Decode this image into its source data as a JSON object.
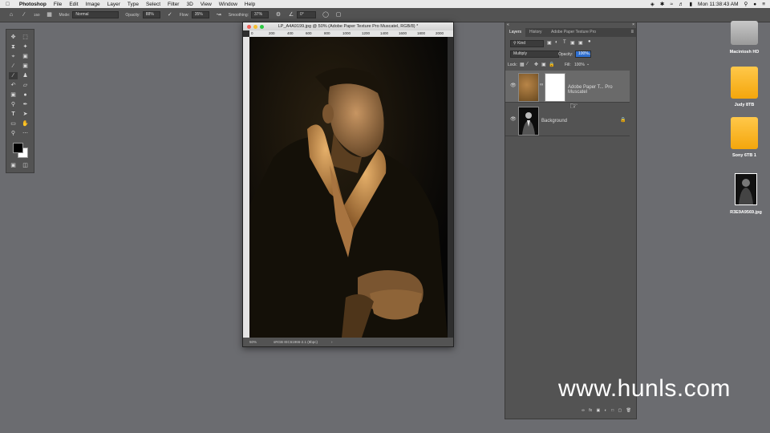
{
  "menubar": {
    "app": "Photoshop",
    "items": [
      "File",
      "Edit",
      "Image",
      "Layer",
      "Type",
      "Select",
      "Filter",
      "3D",
      "View",
      "Window",
      "Help"
    ],
    "clock": "Mon 11:38:43 AM"
  },
  "options": {
    "brush_size": "150",
    "mode_label": "Mode:",
    "mode_value": "Normal",
    "opacity_label": "Opacity:",
    "opacity_value": "88%",
    "flow_label": "Flow:",
    "flow_value": "35%",
    "smoothing_label": "Smoothing:",
    "smoothing_value": "37%",
    "angle_value": "0°"
  },
  "document": {
    "title": "LP_A4A9199.jpg @ 50% (Adobe Paper Texture Pro Muscatel, RGB/8) *",
    "ruler_ticks": [
      "0",
      "200",
      "400",
      "600",
      "800",
      "1000",
      "1200",
      "1400",
      "1600",
      "1800",
      "2000"
    ],
    "zoom": "50%",
    "status": "sRGB IEC61966-2.1 (8bpc)"
  },
  "panel": {
    "tabs": [
      "Layers",
      "History",
      "Adobe Paper Texture Pro"
    ],
    "filter": "Kind",
    "blend_mode": "Multiply",
    "opacity_label": "Opacity:",
    "opacity_value": "100%",
    "lock_label": "Lock:",
    "fill_label": "Fill:",
    "fill_value": "100%",
    "layers": [
      {
        "name": "Adobe Paper T... Pro Muscatel"
      },
      {
        "name": "Background"
      }
    ]
  },
  "desktop": {
    "icons": [
      "Macintosh HD",
      "Judy 8TB",
      "Sony 6TB 1",
      "R3E9A9569.jpg"
    ]
  },
  "watermark": "www.hunls.com",
  "colors": {
    "drive_orange": "#f4a60c",
    "selection_blue": "#2f6fcf",
    "panel_bg": "#535353"
  }
}
